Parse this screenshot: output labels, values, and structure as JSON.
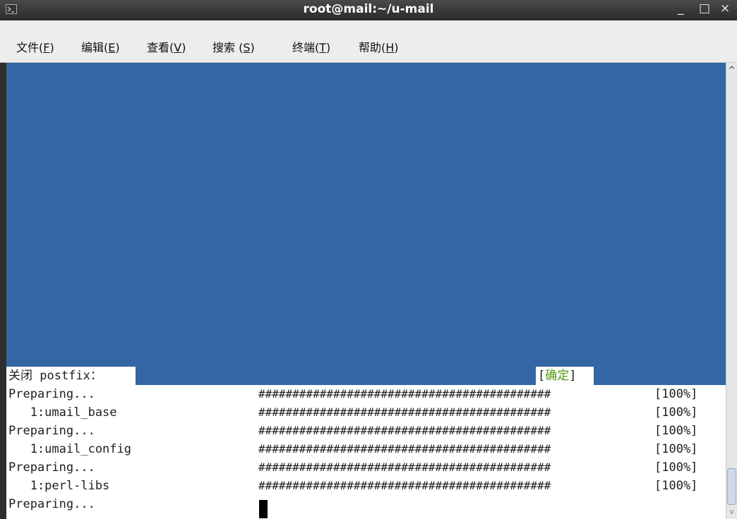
{
  "window": {
    "title": "root@mail:~/u-mail",
    "minimize": "_",
    "maximize": "□",
    "close": "×"
  },
  "menu": [
    {
      "label": "文件(",
      "key": "F",
      "tail": ")"
    },
    {
      "label": "编辑(",
      "key": "E",
      "tail": ")"
    },
    {
      "label": "查看(",
      "key": "V",
      "tail": ")"
    },
    {
      "label": "搜索 (",
      "key": "S",
      "tail": ")"
    },
    {
      "label": "终端(",
      "key": "T",
      "tail": ")"
    },
    {
      "label": "帮助(",
      "key": "H",
      "tail": ")"
    }
  ],
  "terminal": {
    "status_label": "关闭 postfix：",
    "status_ok_open": "[",
    "status_ok_text": "确定",
    "status_ok_close": "]",
    "lines": [
      {
        "text": "Preparing...",
        "hashes": "###########################################",
        "pct": "[100%]"
      },
      {
        "text": "   1:umail_base",
        "hashes": "###########################################",
        "pct": "[100%]"
      },
      {
        "text": "Preparing...",
        "hashes": "###########################################",
        "pct": "[100%]"
      },
      {
        "text": "   1:umail_config",
        "hashes": "###########################################",
        "pct": "[100%]"
      },
      {
        "text": "Preparing...",
        "hashes": "###########################################",
        "pct": "[100%]"
      },
      {
        "text": "   1:perl-libs",
        "hashes": "###########################################",
        "pct": "[100%]"
      },
      {
        "text": "Preparing...",
        "hashes": "",
        "pct": ""
      }
    ]
  },
  "colors": {
    "terminal_blue": "#3465a4",
    "ok_green": "#4e9a06"
  },
  "icons": {
    "window_icon": "terminal-icon"
  }
}
